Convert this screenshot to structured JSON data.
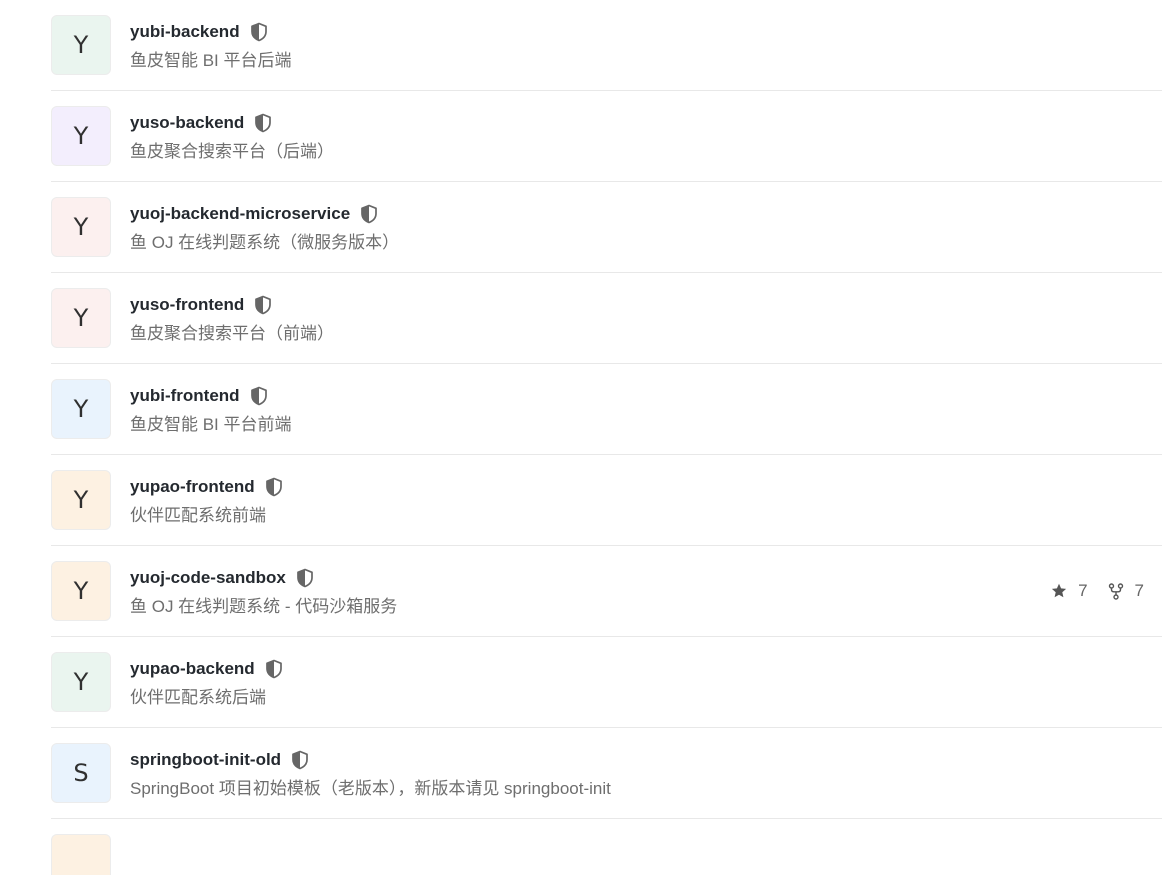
{
  "repositories": [
    {
      "avatar_letter": "Y",
      "avatar_bg": "#eaf5ef",
      "name": "yubi-backend",
      "description": "鱼皮智能 BI 平台后端"
    },
    {
      "avatar_letter": "Y",
      "avatar_bg": "#f3eefd",
      "name": "yuso-backend",
      "description": "鱼皮聚合搜索平台（后端）"
    },
    {
      "avatar_letter": "Y",
      "avatar_bg": "#fcf0ef",
      "name": "yuoj-backend-microservice",
      "description": "鱼 OJ 在线判题系统（微服务版本）"
    },
    {
      "avatar_letter": "Y",
      "avatar_bg": "#fcf0ef",
      "name": "yuso-frontend",
      "description": "鱼皮聚合搜索平台（前端）"
    },
    {
      "avatar_letter": "Y",
      "avatar_bg": "#e9f3fd",
      "name": "yubi-frontend",
      "description": "鱼皮智能 BI 平台前端"
    },
    {
      "avatar_letter": "Y",
      "avatar_bg": "#fdf1e2",
      "name": "yupao-frontend",
      "description": "伙伴匹配系统前端"
    },
    {
      "avatar_letter": "Y",
      "avatar_bg": "#fdf1e2",
      "name": "yuoj-code-sandbox",
      "description": "鱼 OJ 在线判题系统 - 代码沙箱服务",
      "stars": "7",
      "forks": "7"
    },
    {
      "avatar_letter": "Y",
      "avatar_bg": "#eaf5ef",
      "name": "yupao-backend",
      "description": "伙伴匹配系统后端"
    },
    {
      "avatar_letter": "S",
      "avatar_bg": "#e9f3fd",
      "name": "springboot-init-old",
      "description": "SpringBoot 项目初始模板（老版本），新版本请见 springboot-init"
    }
  ],
  "partial_row": {
    "avatar_bg": "#fdf1e2"
  },
  "icons": {
    "visibility": "shield-icon",
    "star": "star-icon",
    "fork": "fork-icon"
  }
}
